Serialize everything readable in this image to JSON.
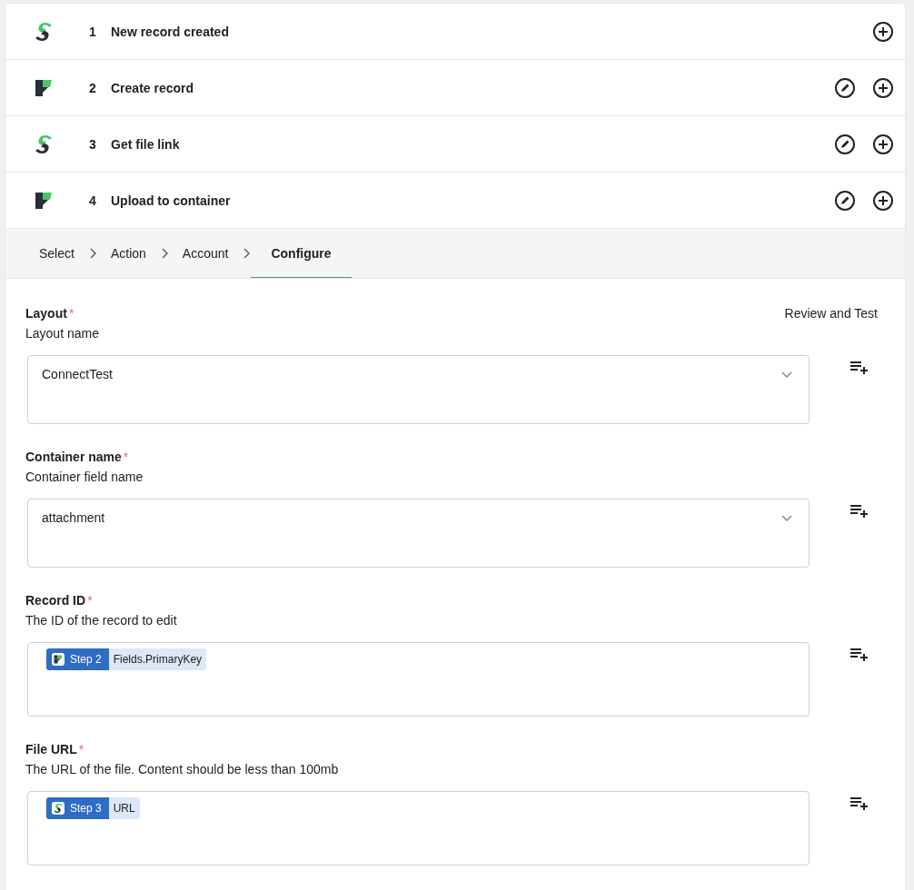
{
  "steps": [
    {
      "number": "1",
      "title": "New record created",
      "kind": "s",
      "editable": false
    },
    {
      "number": "2",
      "title": "Create record",
      "kind": "f",
      "editable": true
    },
    {
      "number": "3",
      "title": "Get file link",
      "kind": "s",
      "editable": true
    },
    {
      "number": "4",
      "title": "Upload to container",
      "kind": "f",
      "editable": true
    }
  ],
  "breadcrumb": [
    {
      "label": "Select",
      "selected": false
    },
    {
      "label": "Action",
      "selected": false
    },
    {
      "label": "Account",
      "selected": false
    },
    {
      "label": "Configure",
      "selected": true
    }
  ],
  "review_link": "Review and Test",
  "fields": [
    {
      "kind": "dropdown",
      "label": "Layout",
      "required_mark": "*",
      "description": "Layout name",
      "value": "ConnectTest"
    },
    {
      "kind": "dropdown",
      "label": "Container name",
      "required_mark": "*",
      "description": "Container field name",
      "value": "attachment"
    },
    {
      "kind": "tokens",
      "label": "Record ID",
      "required_mark": "*",
      "description": "The ID of the record to edit",
      "tokens": [
        {
          "step": "Step 2",
          "kind": "f",
          "path": "Fields.PrimaryKey"
        }
      ]
    },
    {
      "kind": "tokens",
      "label": "File URL",
      "required_mark": "*",
      "description": "The URL of the file. Content should be less than 100mb",
      "tokens": [
        {
          "step": "Step 3",
          "kind": "s",
          "path": "URL"
        }
      ]
    }
  ]
}
